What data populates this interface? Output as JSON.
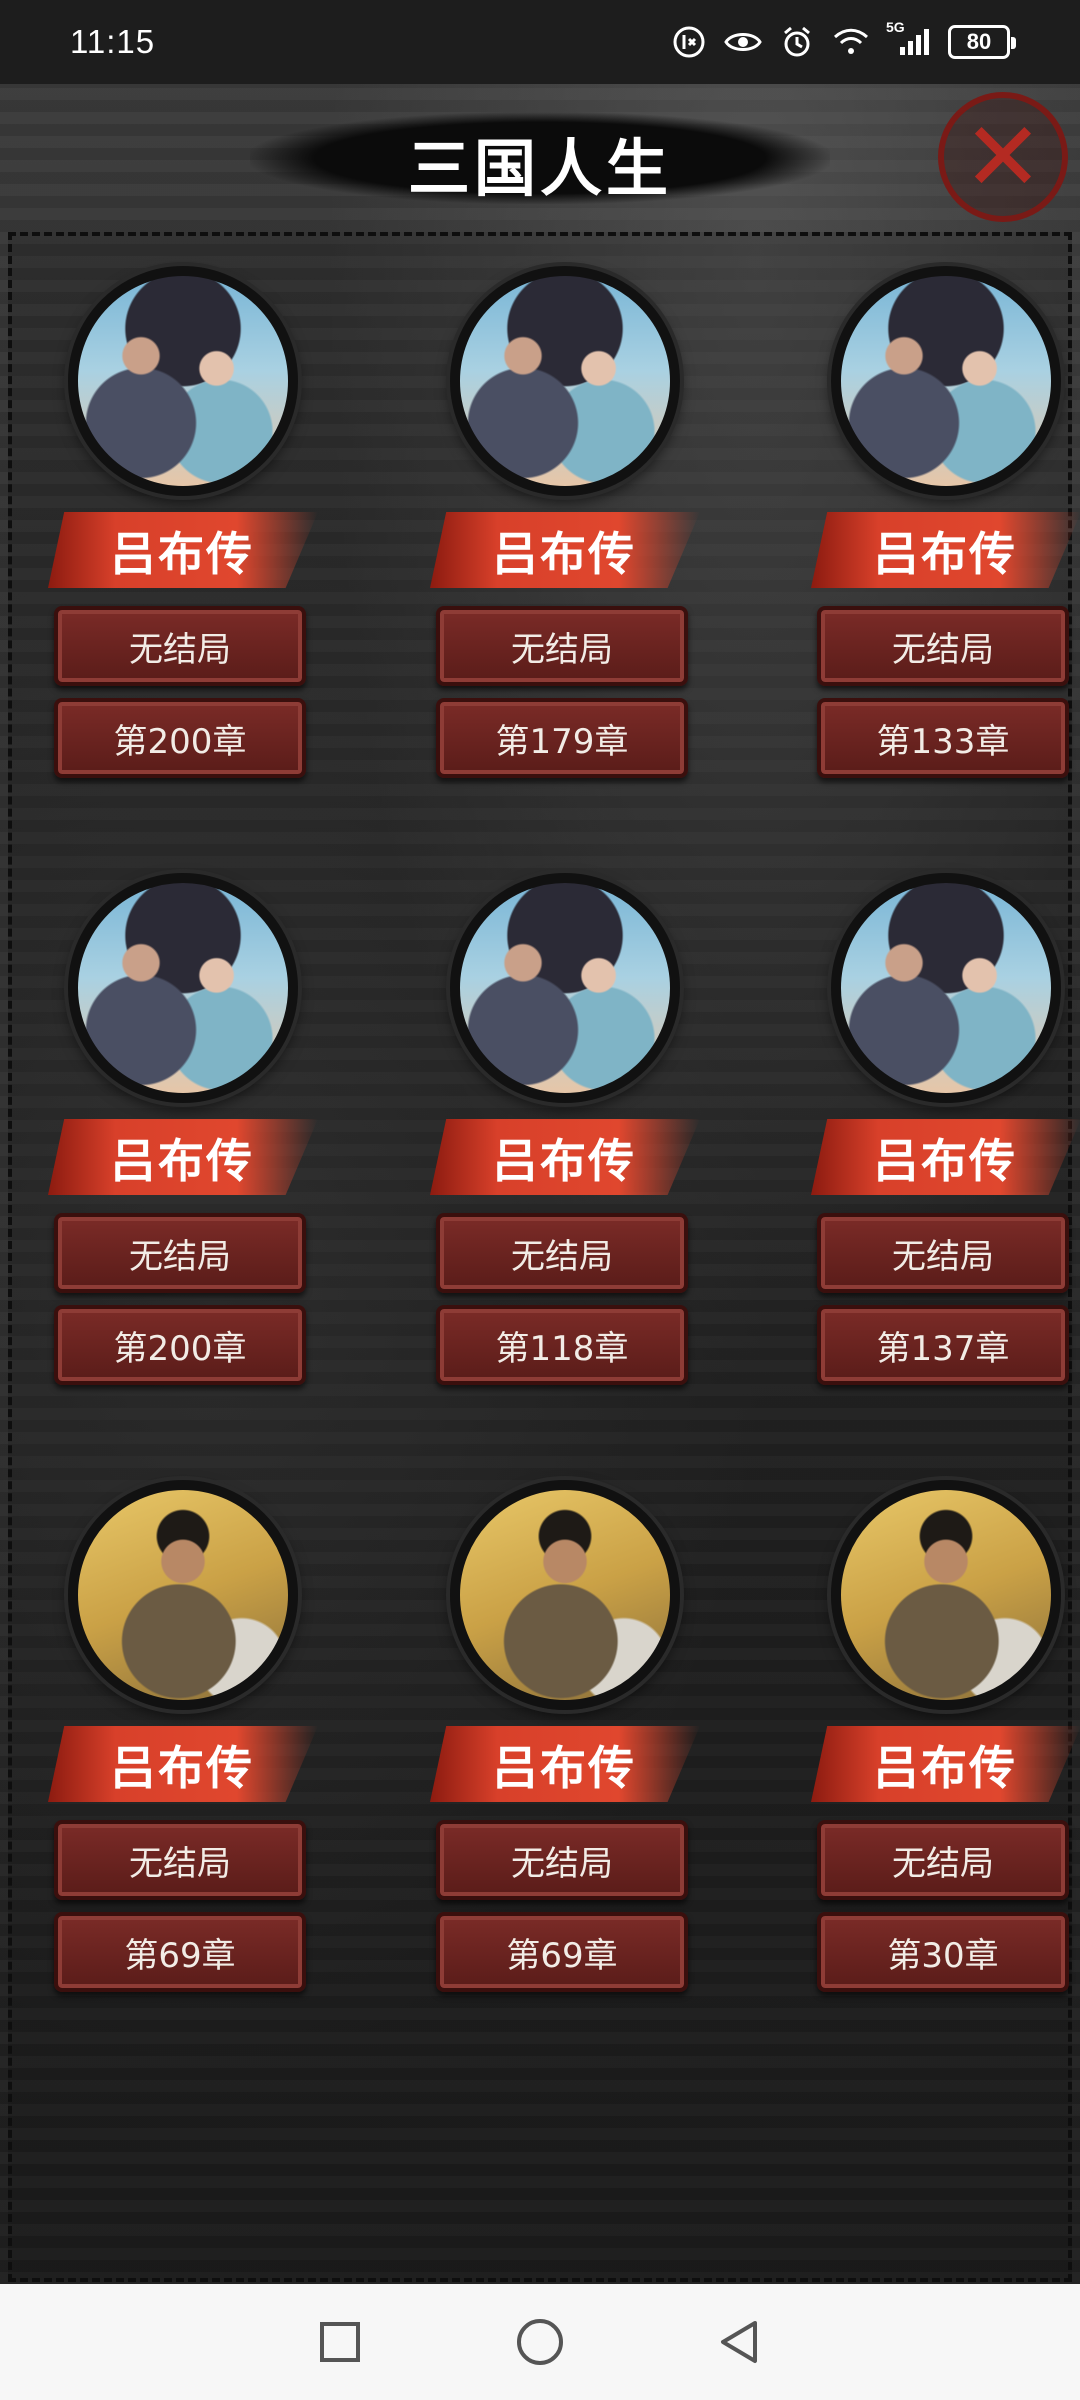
{
  "status_bar": {
    "time": "11:15",
    "signal_label": "5G",
    "battery": "80",
    "icons": [
      "data-saver-icon",
      "eye-icon",
      "alarm-icon",
      "wifi-icon",
      "cell-signal-icon",
      "battery-icon"
    ]
  },
  "header": {
    "title": "三国人生",
    "close_icon": "close-icon"
  },
  "cards": [
    {
      "name": "吕布传",
      "status": "无结局",
      "chapter": "第200章",
      "portrait": "dual"
    },
    {
      "name": "吕布传",
      "status": "无结局",
      "chapter": "第179章",
      "portrait": "dual"
    },
    {
      "name": "吕布传",
      "status": "无结局",
      "chapter": "第133章",
      "portrait": "dual"
    },
    {
      "name": "吕布传",
      "status": "无结局",
      "chapter": "第200章",
      "portrait": "dual"
    },
    {
      "name": "吕布传",
      "status": "无结局",
      "chapter": "第118章",
      "portrait": "dual"
    },
    {
      "name": "吕布传",
      "status": "无结局",
      "chapter": "第137章",
      "portrait": "dual"
    },
    {
      "name": "吕布传",
      "status": "无结局",
      "chapter": "第69章",
      "portrait": "single"
    },
    {
      "name": "吕布传",
      "status": "无结局",
      "chapter": "第69章",
      "portrait": "single"
    },
    {
      "name": "吕布传",
      "status": "无结局",
      "chapter": "第30章",
      "portrait": "single"
    }
  ],
  "nav_bar": {
    "icons": [
      "recents-square-icon",
      "home-circle-icon",
      "back-triangle-icon"
    ]
  },
  "colors": {
    "banner": "#e0472e",
    "button": "#6a2420",
    "close": "#b42a22"
  }
}
